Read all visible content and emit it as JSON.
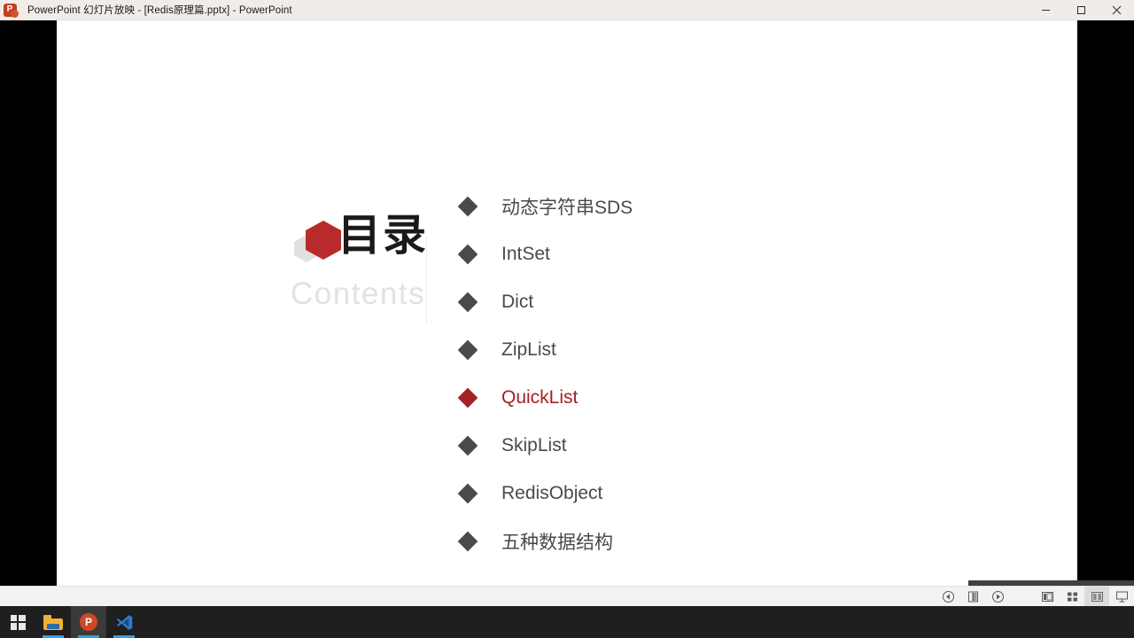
{
  "window": {
    "title": "PowerPoint 幻灯片放映 - [Redis原理篇.pptx] - PowerPoint",
    "app_icon": "powerpoint-icon",
    "controls": {
      "minimize": "minimize-icon",
      "maximize": "restore-icon",
      "close": "close-icon"
    }
  },
  "slide": {
    "heading_cn": "目录",
    "heading_en": "Contents",
    "logo_icon": "hexagon-logo-icon",
    "accent_color": "#a52a2a",
    "highlight_color": "#a52026",
    "text_color": "#4a4a4a",
    "items": [
      {
        "label": "动态字符串SDS",
        "active": false
      },
      {
        "label": "IntSet",
        "active": false
      },
      {
        "label": "Dict",
        "active": false
      },
      {
        "label": "ZipList",
        "active": false
      },
      {
        "label": "QuickList",
        "active": true
      },
      {
        "label": "SkipList",
        "active": false
      },
      {
        "label": "RedisObject",
        "active": false
      },
      {
        "label": "五种数据结构",
        "active": false
      }
    ]
  },
  "show_controls": {
    "previous": "previous-slide-icon",
    "pause": "pause-icon",
    "next": "next-slide-icon"
  },
  "view_controls": [
    {
      "name": "normal-view-icon",
      "active": false
    },
    {
      "name": "slide-sorter-view-icon",
      "active": false
    },
    {
      "name": "reading-view-icon",
      "active": true
    },
    {
      "name": "slide-show-view-icon",
      "active": false
    }
  ],
  "taskbar": {
    "items": [
      {
        "name": "start-button-icon",
        "running": false,
        "active": false
      },
      {
        "name": "file-explorer-icon",
        "running": true,
        "active": false
      },
      {
        "name": "powerpoint-taskbar-icon",
        "running": true,
        "active": true
      },
      {
        "name": "vscode-icon",
        "running": true,
        "active": false
      }
    ]
  }
}
